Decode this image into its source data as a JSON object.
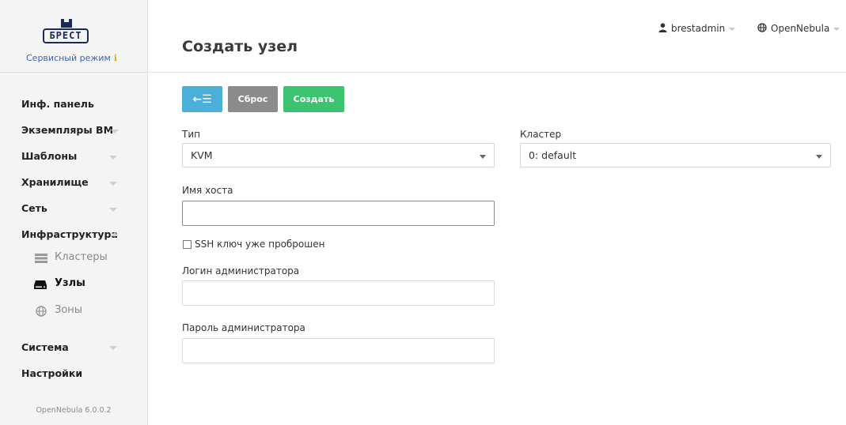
{
  "sidebar": {
    "logo_text": "БРЕСТ",
    "service_mode": "Сервисный режим",
    "service_mode_icon": "info-icon",
    "items": [
      {
        "label": "Инф. панель"
      },
      {
        "label": "Экземпляры ВМ"
      },
      {
        "label": "Шаблоны"
      },
      {
        "label": "Хранилище"
      },
      {
        "label": "Сеть"
      },
      {
        "label": "Инфраструктура"
      },
      {
        "label": "Система"
      },
      {
        "label": "Настройки"
      }
    ],
    "sub_items": [
      {
        "label": "Кластеры",
        "icon": "server-stack-icon"
      },
      {
        "label": "Узлы",
        "icon": "host-drive-icon"
      },
      {
        "label": "Зоны",
        "icon": "globe-icon"
      }
    ],
    "footer": "OpenNebula 6.0.0.2"
  },
  "header": {
    "title": "Создать узел",
    "user": "brestadmin",
    "zone": "OpenNebula"
  },
  "toolbar": {
    "back_icon": "←☰",
    "reset_label": "Сброс",
    "create_label": "Создать"
  },
  "form": {
    "type_label": "Тип",
    "type_value": "KVM",
    "cluster_label": "Кластер",
    "cluster_value": "0: default",
    "hostname_label": "Имя хоста",
    "hostname_value": "",
    "ssh_checkbox_label": "SSH ключ уже проброшен",
    "admin_login_label": "Логин администратора",
    "admin_login_value": "",
    "admin_password_label": "Пароль администратора",
    "admin_password_value": ""
  },
  "colors": {
    "back_button": "#4ab0d9",
    "reset_button": "#8b8b8b",
    "create_button": "#3cc36f",
    "service_mode_text": "#3a64b8"
  }
}
